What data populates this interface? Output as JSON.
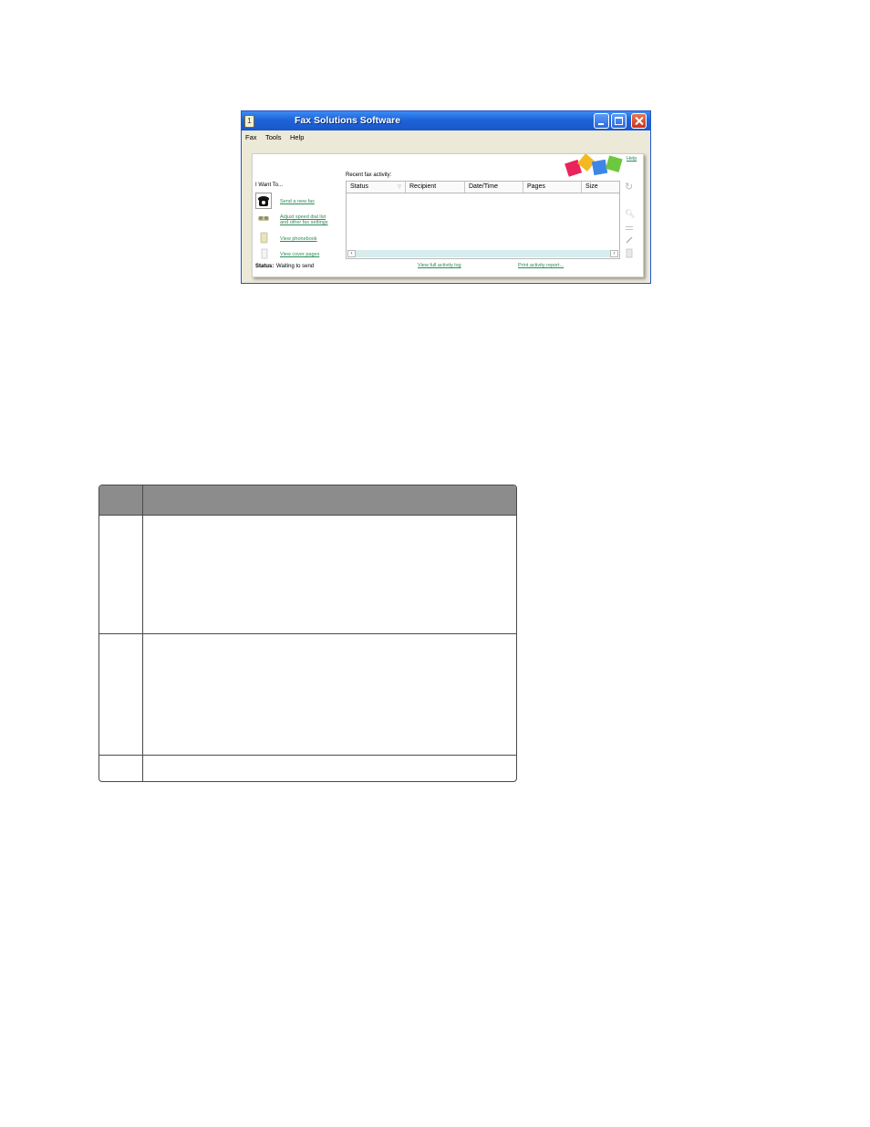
{
  "window": {
    "title": "Fax Solutions Software",
    "icon": "fax-app-icon",
    "controls": [
      "minimize-icon",
      "maximize-icon",
      "close-icon"
    ]
  },
  "menu": [
    "Fax",
    "Tools",
    "Help"
  ],
  "help_link": "Help",
  "decoration": {
    "sticky_notes_colors": [
      "#e8245a",
      "#f4b822",
      "#3d86e8",
      "#6cc83c"
    ]
  },
  "i_want_to": {
    "heading": "I Want To...",
    "actions": [
      {
        "label": "Send a new fax",
        "icon": "fax-machine-icon"
      },
      {
        "label_line1": "Adjust speed dial list",
        "label_line2": "and other fax settings",
        "icon": "settings-icon"
      },
      {
        "label": "View phonebook",
        "icon": "phonebook-icon"
      },
      {
        "label": "View cover pages",
        "icon": "cover-page-icon"
      }
    ]
  },
  "status": {
    "label": "Status:",
    "value": "Waiting to send"
  },
  "recent": {
    "heading": "Recent fax activity:",
    "columns": [
      "Status",
      "Recipient",
      "Date/Time",
      "Pages",
      "Size"
    ],
    "rows": []
  },
  "links": {
    "view_log": "View full activity log",
    "print_report": "Print activity report..."
  },
  "side_tools": [
    "refresh-icon",
    "search-icon",
    "list-icon",
    "edit-icon",
    "delete-icon"
  ],
  "doc_table": {
    "header": [
      "",
      ""
    ],
    "rows": [
      [
        "",
        ""
      ],
      [
        "",
        ""
      ],
      [
        "",
        ""
      ]
    ]
  }
}
